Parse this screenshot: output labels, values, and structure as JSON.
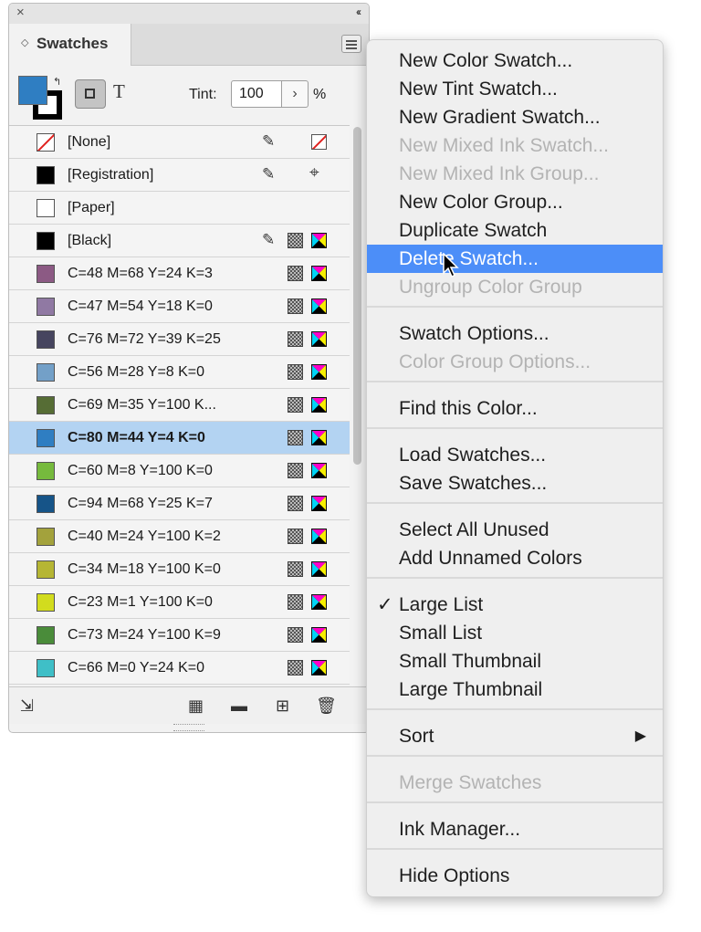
{
  "panel": {
    "close_glyph": "×",
    "collapse_glyph": "‹‹",
    "tab_title": "Swatches",
    "tint_label": "Tint:",
    "tint_value": "100",
    "tint_unit": "%",
    "text_button": "T",
    "swatches": [
      {
        "label": "[None]",
        "color": "none",
        "pencil": true,
        "type": "none"
      },
      {
        "label": "[Registration]",
        "color": "#000000",
        "pencil": true,
        "type": "registration"
      },
      {
        "label": "[Paper]",
        "color": "#ffffff",
        "pencil": false,
        "type": "blank"
      },
      {
        "label": "[Black]",
        "color": "#000000",
        "pencil": true,
        "type": "process"
      },
      {
        "label": "C=48 M=68 Y=24 K=3",
        "color": "#8c5a84",
        "type": "process"
      },
      {
        "label": "C=47 M=54 Y=18 K=0",
        "color": "#9079a3",
        "type": "process"
      },
      {
        "label": "C=76 M=72 Y=39 K=25",
        "color": "#46455f",
        "type": "process"
      },
      {
        "label": "C=56 M=28 Y=8 K=0",
        "color": "#73a0c8",
        "type": "process"
      },
      {
        "label": "C=69 M=35 Y=100 K...",
        "color": "#566d35",
        "type": "process"
      },
      {
        "label": "C=80 M=44 Y=4 K=0",
        "color": "#2f7ec2",
        "type": "process",
        "selected": true
      },
      {
        "label": "C=60 M=8 Y=100 K=0",
        "color": "#76ba3d",
        "type": "process"
      },
      {
        "label": "C=94 M=68 Y=25 K=7",
        "color": "#165488",
        "type": "process"
      },
      {
        "label": "C=40 M=24 Y=100 K=2",
        "color": "#a3a23c",
        "type": "process"
      },
      {
        "label": "C=34 M=18 Y=100 K=0",
        "color": "#b6b634",
        "type": "process"
      },
      {
        "label": "C=23 M=1 Y=100 K=0",
        "color": "#d2dc1e",
        "type": "process"
      },
      {
        "label": "C=73 M=24 Y=100 K=9",
        "color": "#4a8c3a",
        "type": "process"
      },
      {
        "label": "C=66 M=0 Y=24 K=0",
        "color": "#3fbfc7",
        "type": "process"
      }
    ]
  },
  "menu": {
    "items": [
      {
        "label": "New Color Swatch...",
        "enabled": true
      },
      {
        "label": "New Tint Swatch...",
        "enabled": true
      },
      {
        "label": "New Gradient Swatch...",
        "enabled": true
      },
      {
        "label": "New Mixed Ink Swatch...",
        "enabled": false
      },
      {
        "label": "New Mixed Ink Group...",
        "enabled": false
      },
      {
        "label": "New Color Group...",
        "enabled": true
      },
      {
        "label": "Duplicate Swatch",
        "enabled": true
      },
      {
        "label": "Delete Swatch...",
        "enabled": true,
        "highlighted": true
      },
      {
        "label": "Ungroup Color Group",
        "enabled": false
      },
      {
        "separator": true
      },
      {
        "label": "Swatch Options...",
        "enabled": true
      },
      {
        "label": "Color Group Options...",
        "enabled": false
      },
      {
        "separator": true
      },
      {
        "label": "Find this Color...",
        "enabled": true
      },
      {
        "separator": true
      },
      {
        "label": "Load Swatches...",
        "enabled": true
      },
      {
        "label": "Save Swatches...",
        "enabled": true
      },
      {
        "separator": true
      },
      {
        "label": "Select All Unused",
        "enabled": true
      },
      {
        "label": "Add Unnamed Colors",
        "enabled": true
      },
      {
        "separator": true
      },
      {
        "label": "Large List",
        "enabled": true,
        "checked": true
      },
      {
        "label": "Small List",
        "enabled": true
      },
      {
        "label": "Small Thumbnail",
        "enabled": true
      },
      {
        "label": "Large Thumbnail",
        "enabled": true
      },
      {
        "separator": true
      },
      {
        "label": "Sort",
        "enabled": true,
        "submenu": true
      },
      {
        "separator": true
      },
      {
        "label": "Merge Swatches",
        "enabled": false
      },
      {
        "separator": true
      },
      {
        "label": "Ink Manager...",
        "enabled": true
      },
      {
        "separator": true
      },
      {
        "label": "Hide Options",
        "enabled": true
      }
    ],
    "check_glyph": "✓",
    "submenu_glyph": "▶"
  }
}
